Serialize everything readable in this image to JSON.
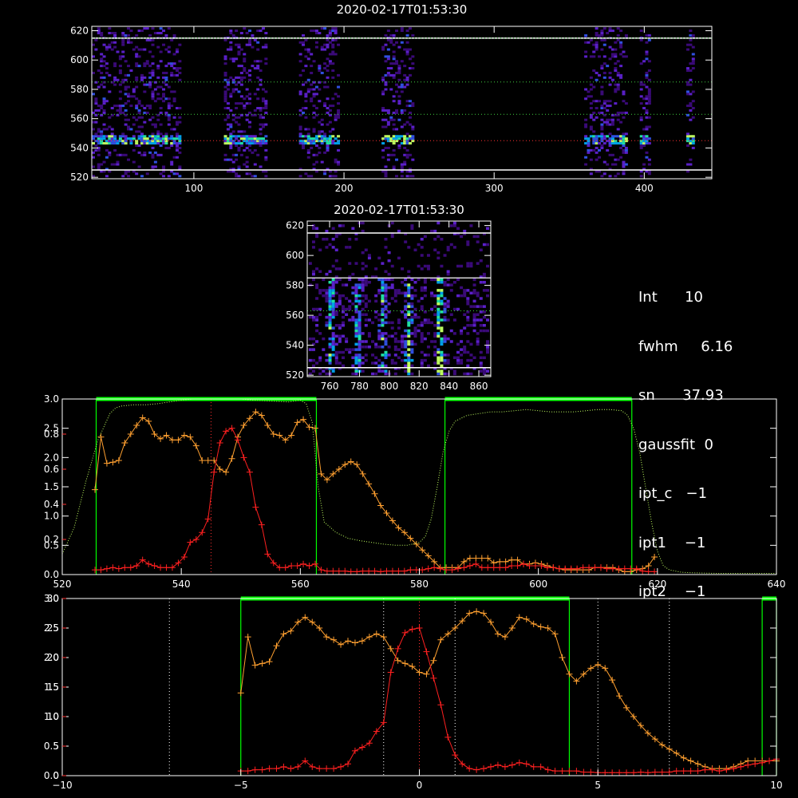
{
  "chart_data": [
    {
      "type": "heatmap",
      "title": "2020-02-17T01:53:30",
      "xlim": [
        32,
        445
      ],
      "ylim": [
        519,
        623
      ],
      "xticks": [
        100,
        200,
        300,
        400
      ],
      "yticks": [
        520,
        540,
        560,
        580,
        600,
        620
      ],
      "xtick_labels": [
        "100",
        "200",
        "300",
        "400"
      ],
      "ytick_labels": [
        "520",
        "540",
        "560",
        "580",
        "600",
        "620"
      ],
      "bands_x": [
        [
          32,
          90
        ],
        [
          120,
          148
        ],
        [
          170,
          196
        ],
        [
          225,
          245
        ],
        [
          360,
          388
        ],
        [
          397,
          404
        ],
        [
          428,
          432
        ]
      ],
      "hlines_white": [
        525,
        615
      ],
      "hlines_green_dotted": [
        615,
        585,
        563
      ],
      "hline_red_dotted": 545
    },
    {
      "type": "heatmap",
      "title": "2020-02-17T01:53:30",
      "xlim": [
        745,
        868
      ],
      "ylim": [
        519,
        623
      ],
      "xticks": [
        760,
        780,
        800,
        820,
        840,
        860
      ],
      "yticks": [
        520,
        540,
        560,
        580,
        600,
        620
      ],
      "xtick_labels": [
        "760",
        "780",
        "800",
        "820",
        "840",
        "860"
      ],
      "ytick_labels": [
        "520",
        "540",
        "560",
        "580",
        "600",
        "620"
      ],
      "stripes_x": [
        760,
        778,
        795,
        812,
        833
      ]
    },
    {
      "type": "line",
      "xlim": [
        520,
        640
      ],
      "ylim": [
        0,
        3
      ],
      "xticks": [
        520,
        540,
        560,
        580,
        600,
        620,
        640
      ],
      "xtick_labels": [
        "520",
        "540",
        "560",
        "580",
        "600",
        "620",
        "640"
      ],
      "yticks_white": [
        0,
        0.5,
        1.0,
        1.5,
        2.0,
        2.5,
        3.0
      ],
      "ytick_labels_white": [
        "0.0",
        "0.5",
        "1.0",
        "1.5",
        "2.0",
        "2.5",
        "3.0"
      ],
      "yticks_red": [
        0.2,
        0.4,
        0.6,
        0.8
      ],
      "ytick_labels_red": [
        "0.2",
        "0.4",
        "0.6",
        "0.8"
      ],
      "green_windows": [
        [
          525.7,
          562.7
        ],
        [
          584.3,
          615.7
        ]
      ],
      "red_vline": 545,
      "colors": {
        "orange": "#ffa030",
        "red": "#ff2020",
        "green": "#00ff00",
        "green_dotted": "#c0ff60"
      },
      "series": [
        {
          "color": "orange",
          "x": [
            525.5,
            526.5,
            527.5,
            528.5,
            529.5,
            530.5,
            531.5,
            532.5,
            533.5,
            534.5,
            535.5,
            536.5,
            537.5,
            538.5,
            539.5,
            540.5,
            541.5,
            542.5,
            543.5,
            544.5,
            545.5,
            546.5,
            547.5,
            548.5,
            549.5,
            550.5,
            551.5,
            552.5,
            553.5,
            554.5,
            555.5,
            556.5,
            557.5,
            558.5,
            559.5,
            560.5,
            561.5,
            562.5,
            563.5,
            564.5,
            565.5,
            566.5,
            567.5,
            568.5,
            569.5,
            570.5,
            571.5,
            572.5,
            573.5,
            574.5,
            575.5,
            576.5,
            577.5,
            578.5,
            579.5,
            580.5,
            581.5,
            582.5,
            583.5,
            584.5,
            585.5,
            586.5,
            587.5,
            588.5,
            589.5,
            590.5,
            591.5,
            592.5,
            593.5,
            594.5,
            595.5,
            596.5,
            597.5,
            598.5,
            599.5,
            600.5,
            601.5,
            602.5,
            603.5,
            604.5,
            605.5,
            606.5,
            607.5,
            608.5,
            609.5,
            610.5,
            611.5,
            612.5,
            613.5,
            614.5,
            615.5,
            616.5,
            617.5,
            618.5,
            619.5
          ],
          "y": [
            1.45,
            2.35,
            1.9,
            1.92,
            1.95,
            2.25,
            2.4,
            2.55,
            2.68,
            2.62,
            2.4,
            2.32,
            2.38,
            2.3,
            2.3,
            2.38,
            2.35,
            2.2,
            1.95,
            1.95,
            1.95,
            1.8,
            1.75,
            1.98,
            2.35,
            2.55,
            2.67,
            2.78,
            2.72,
            2.55,
            2.4,
            2.38,
            2.3,
            2.38,
            2.6,
            2.65,
            2.52,
            2.5,
            1.72,
            1.62,
            1.72,
            1.8,
            1.88,
            1.93,
            1.88,
            1.72,
            1.55,
            1.38,
            1.18,
            1.05,
            0.92,
            0.8,
            0.72,
            0.62,
            0.52,
            0.42,
            0.32,
            0.22,
            0.12,
            0.12,
            0.12,
            0.12,
            0.22,
            0.28,
            0.28,
            0.28,
            0.28,
            0.2,
            0.22,
            0.22,
            0.25,
            0.25,
            0.18,
            0.18,
            0.2,
            0.18,
            0.15,
            0.12,
            0.1,
            0.08,
            0.08,
            0.08,
            0.08,
            0.08,
            0.12,
            0.12,
            0.12,
            0.12,
            0.08,
            0.05,
            0.05,
            0.08,
            0.1,
            0.15,
            0.3
          ]
        },
        {
          "color": "red",
          "x": [
            525.5,
            526.5,
            527.5,
            528.5,
            529.5,
            530.5,
            531.5,
            532.5,
            533.5,
            534.5,
            535.5,
            536.5,
            537.5,
            538.5,
            539.5,
            540.5,
            541.5,
            542.5,
            543.5,
            544.5,
            545.5,
            546.5,
            547.5,
            548.5,
            549.5,
            550.5,
            551.5,
            552.5,
            553.5,
            554.5,
            555.5,
            556.5,
            557.5,
            558.5,
            559.5,
            560.5,
            561.5,
            562.5,
            563.5,
            564.5,
            565.5,
            566.5,
            567.5,
            568.5,
            569.5,
            570.5,
            571.5,
            572.5,
            573.5,
            574.5,
            575.5,
            576.5,
            577.5,
            578.5,
            579.5,
            580.5,
            581.5,
            582.5,
            583.5,
            584.5,
            585.5,
            586.5,
            587.5,
            588.5,
            589.5,
            590.5,
            591.5,
            592.5,
            593.5,
            594.5,
            595.5,
            596.5,
            597.5,
            598.5,
            599.5,
            600.5,
            601.5,
            602.5,
            603.5,
            604.5,
            605.5,
            606.5,
            607.5,
            608.5,
            609.5,
            610.5,
            611.5,
            612.5,
            613.5,
            614.5,
            615.5,
            616.5,
            617.5,
            618.5,
            619.5
          ],
          "y": [
            0.08,
            0.08,
            0.1,
            0.12,
            0.1,
            0.12,
            0.12,
            0.15,
            0.25,
            0.18,
            0.15,
            0.12,
            0.12,
            0.12,
            0.2,
            0.3,
            0.55,
            0.6,
            0.72,
            0.95,
            1.75,
            2.25,
            2.45,
            2.5,
            2.3,
            2.0,
            1.75,
            1.15,
            0.85,
            0.35,
            0.2,
            0.12,
            0.12,
            0.15,
            0.15,
            0.18,
            0.15,
            0.18,
            0.08,
            0.06,
            0.06,
            0.06,
            0.06,
            0.05,
            0.05,
            0.06,
            0.06,
            0.06,
            0.05,
            0.06,
            0.06,
            0.06,
            0.06,
            0.08,
            0.08,
            0.08,
            0.1,
            0.12,
            0.1,
            0.08,
            0.08,
            0.1,
            0.12,
            0.15,
            0.18,
            0.12,
            0.12,
            0.12,
            0.12,
            0.12,
            0.15,
            0.15,
            0.18,
            0.15,
            0.15,
            0.15,
            0.12,
            0.12,
            0.1,
            0.1,
            0.1,
            0.1,
            0.12,
            0.12,
            0.12,
            0.12,
            0.1,
            0.1,
            0.1,
            0.1,
            0.1,
            0.1,
            0.06,
            0.05,
            0.05
          ]
        },
        {
          "color": "green_dotted",
          "x": [
            520,
            522,
            524,
            526,
            528,
            529,
            530,
            532,
            534,
            536,
            538,
            540,
            542,
            544,
            546,
            548,
            550,
            552,
            554,
            556,
            558,
            560,
            561,
            562,
            563,
            564,
            566,
            568,
            570,
            572,
            574,
            576,
            578,
            580,
            581,
            582,
            583,
            584,
            585,
            586,
            588,
            590,
            592,
            594,
            596,
            598,
            600,
            602,
            604,
            606,
            608,
            610,
            612,
            614,
            615,
            616,
            617,
            618,
            619,
            620,
            621,
            622,
            624,
            626,
            630,
            635,
            640
          ],
          "y": [
            0.35,
            0.8,
            1.6,
            2.3,
            2.75,
            2.85,
            2.88,
            2.9,
            2.9,
            2.92,
            2.95,
            2.98,
            3.0,
            3.0,
            3.0,
            3.0,
            3.0,
            2.98,
            2.97,
            2.96,
            2.95,
            2.98,
            2.92,
            2.6,
            1.5,
            0.9,
            0.72,
            0.62,
            0.58,
            0.55,
            0.52,
            0.5,
            0.5,
            0.55,
            0.65,
            0.95,
            1.5,
            2.1,
            2.45,
            2.62,
            2.72,
            2.75,
            2.78,
            2.78,
            2.8,
            2.82,
            2.8,
            2.78,
            2.78,
            2.78,
            2.8,
            2.82,
            2.82,
            2.8,
            2.72,
            2.5,
            2.1,
            1.5,
            0.9,
            0.4,
            0.15,
            0.08,
            0.04,
            0.03,
            0.02,
            0.02,
            0.02
          ]
        }
      ]
    },
    {
      "type": "line",
      "xlim": [
        -10,
        10
      ],
      "ylim": [
        0,
        3
      ],
      "xticks": [
        -10,
        -5,
        0,
        5,
        10
      ],
      "xtick_labels": [
        "−10",
        "−5",
        "0",
        "5",
        "10"
      ],
      "yticks_white": [
        0,
        0.5,
        1.0,
        1.5,
        2.0,
        2.5,
        3.0
      ],
      "ytick_labels_white": [
        "0.0",
        "0.5",
        "1.0",
        "1.5",
        "2.0",
        "2.5",
        "3.0"
      ],
      "yticks_red": [
        0,
        5,
        10,
        15,
        20,
        25,
        30
      ],
      "ytick_labels_red": [
        "0",
        "5",
        "10",
        "15",
        "20",
        "25",
        "30"
      ],
      "green_windows": [
        [
          -5,
          4.2
        ],
        [
          9.6,
          10
        ]
      ],
      "white_vlines": [
        -7,
        -1,
        1,
        5,
        7
      ],
      "red_vline": 0,
      "colors": {
        "orange": "#ffa030",
        "red": "#ff2020",
        "green": "#00ff00"
      },
      "series": [
        {
          "color": "orange",
          "x": [
            -5.0,
            -4.8,
            -4.6,
            -4.4,
            -4.2,
            -4.0,
            -3.8,
            -3.6,
            -3.4,
            -3.2,
            -3.0,
            -2.8,
            -2.6,
            -2.4,
            -2.2,
            -2.0,
            -1.8,
            -1.6,
            -1.4,
            -1.2,
            -1.0,
            -0.8,
            -0.6,
            -0.4,
            -0.2,
            0.0,
            0.2,
            0.4,
            0.6,
            0.8,
            1.0,
            1.2,
            1.4,
            1.6,
            1.8,
            2.0,
            2.2,
            2.4,
            2.6,
            2.8,
            3.0,
            3.2,
            3.4,
            3.6,
            3.8,
            4.0,
            4.2,
            4.4,
            4.6,
            4.8,
            5.0,
            5.2,
            5.4,
            5.6,
            5.8,
            6.0,
            6.2,
            6.4,
            6.6,
            6.8,
            7.0,
            7.2,
            7.4,
            7.6,
            7.8,
            8.0,
            8.2,
            8.4,
            8.6,
            8.8,
            9.0,
            9.2,
            9.4,
            9.6,
            9.8,
            10.0
          ],
          "y": [
            1.4,
            2.35,
            1.87,
            1.9,
            1.93,
            2.2,
            2.4,
            2.45,
            2.6,
            2.68,
            2.6,
            2.5,
            2.35,
            2.3,
            2.22,
            2.28,
            2.25,
            2.28,
            2.35,
            2.4,
            2.35,
            2.15,
            1.95,
            1.9,
            1.85,
            1.75,
            1.72,
            1.95,
            2.3,
            2.4,
            2.5,
            2.62,
            2.75,
            2.78,
            2.75,
            2.6,
            2.4,
            2.35,
            2.5,
            2.68,
            2.65,
            2.57,
            2.52,
            2.5,
            2.4,
            2.0,
            1.72,
            1.6,
            1.72,
            1.82,
            1.88,
            1.82,
            1.62,
            1.35,
            1.15,
            1.0,
            0.85,
            0.72,
            0.62,
            0.52,
            0.45,
            0.38,
            0.3,
            0.25,
            0.2,
            0.15,
            0.12,
            0.12,
            0.12,
            0.15,
            0.2,
            0.25,
            0.25,
            0.25,
            0.25,
            0.25
          ]
        },
        {
          "color": "red",
          "x": [
            -5.0,
            -4.8,
            -4.6,
            -4.4,
            -4.2,
            -4.0,
            -3.8,
            -3.6,
            -3.4,
            -3.2,
            -3.0,
            -2.8,
            -2.6,
            -2.4,
            -2.2,
            -2.0,
            -1.8,
            -1.6,
            -1.4,
            -1.2,
            -1.0,
            -0.8,
            -0.6,
            -0.4,
            -0.2,
            0.0,
            0.2,
            0.4,
            0.6,
            0.8,
            1.0,
            1.2,
            1.4,
            1.6,
            1.8,
            2.0,
            2.2,
            2.4,
            2.6,
            2.8,
            3.0,
            3.2,
            3.4,
            3.6,
            3.8,
            4.0,
            4.2,
            4.4,
            4.6,
            4.8,
            5.0,
            5.2,
            5.4,
            5.6,
            5.8,
            6.0,
            6.2,
            6.4,
            6.6,
            6.8,
            7.0,
            7.2,
            7.4,
            7.6,
            7.8,
            8.0,
            8.2,
            8.4,
            8.6,
            8.8,
            9.0,
            9.2,
            9.4,
            9.6,
            9.8,
            10.0
          ],
          "y": [
            0.08,
            0.08,
            0.1,
            0.1,
            0.12,
            0.12,
            0.15,
            0.12,
            0.15,
            0.25,
            0.15,
            0.12,
            0.12,
            0.12,
            0.15,
            0.2,
            0.42,
            0.48,
            0.55,
            0.75,
            0.9,
            1.75,
            2.15,
            2.42,
            2.48,
            2.5,
            2.1,
            1.65,
            1.2,
            0.65,
            0.35,
            0.2,
            0.12,
            0.1,
            0.12,
            0.15,
            0.18,
            0.15,
            0.18,
            0.22,
            0.2,
            0.15,
            0.15,
            0.1,
            0.08,
            0.08,
            0.08,
            0.08,
            0.06,
            0.06,
            0.05,
            0.05,
            0.05,
            0.05,
            0.05,
            0.05,
            0.06,
            0.05,
            0.06,
            0.06,
            0.06,
            0.08,
            0.08,
            0.08,
            0.08,
            0.1,
            0.1,
            0.08,
            0.1,
            0.12,
            0.15,
            0.18,
            0.2,
            0.22,
            0.25,
            0.28
          ]
        }
      ]
    }
  ],
  "info": {
    "lines": [
      "Int      10",
      "fwhm     6.16",
      "sn      37.93",
      "gaussfit  0",
      "ipt_c   −1",
      "ipt1    −1",
      "ipt2    −1"
    ]
  }
}
